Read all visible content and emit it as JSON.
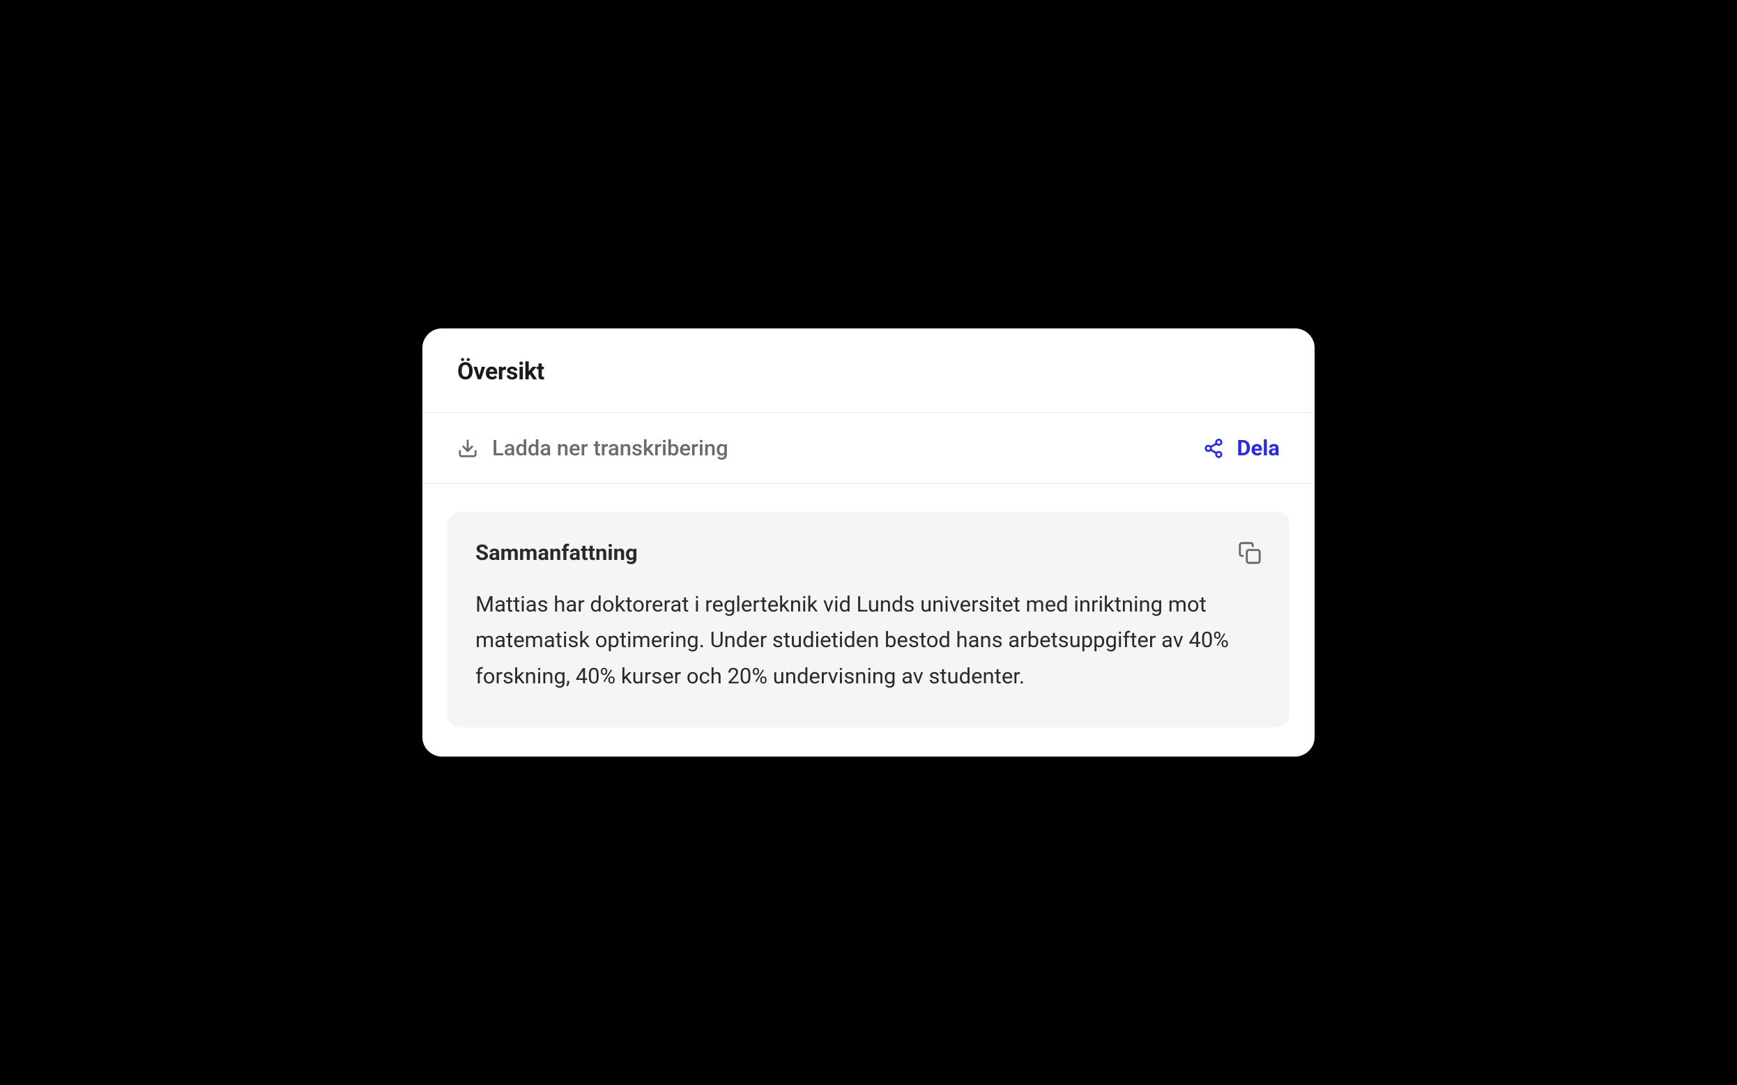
{
  "header": {
    "title": "Översikt"
  },
  "actions": {
    "download_label": "Ladda ner transkribering",
    "share_label": "Dela"
  },
  "summary": {
    "title": "Sammanfattning",
    "text": "Mattias har doktorerat i reglerteknik vid Lunds universitet med inriktning mot matematisk optimering. Under studietiden bestod hans arbetsuppgifter av 40% forskning, 40% kurser och 20% undervisning av studenter."
  }
}
